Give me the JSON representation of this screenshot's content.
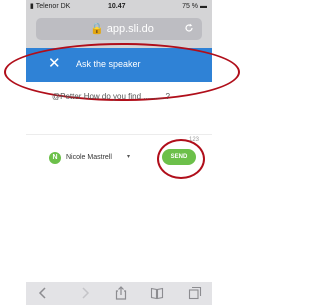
{
  "status_bar": {
    "carrier": "Telenor DK",
    "time": "10.47",
    "battery": "75 %"
  },
  "browser": {
    "url": "app.sli.do"
  },
  "slido": {
    "header_title": "Ask the speaker",
    "question_text": "@Petter How do you find ..........?",
    "char_count": "123",
    "user_name": "Nicole Mastrell",
    "avatar_initial": "N",
    "send_label": "SEND"
  },
  "colors": {
    "header_blue": "#2f82d6",
    "send_green": "#6cc04a",
    "annotation_red": "#b00e1a"
  },
  "icons": [
    "back-icon",
    "forward-icon",
    "share-icon",
    "bookmarks-icon",
    "tabs-icon",
    "reload-icon",
    "lock-icon",
    "close-icon"
  ]
}
